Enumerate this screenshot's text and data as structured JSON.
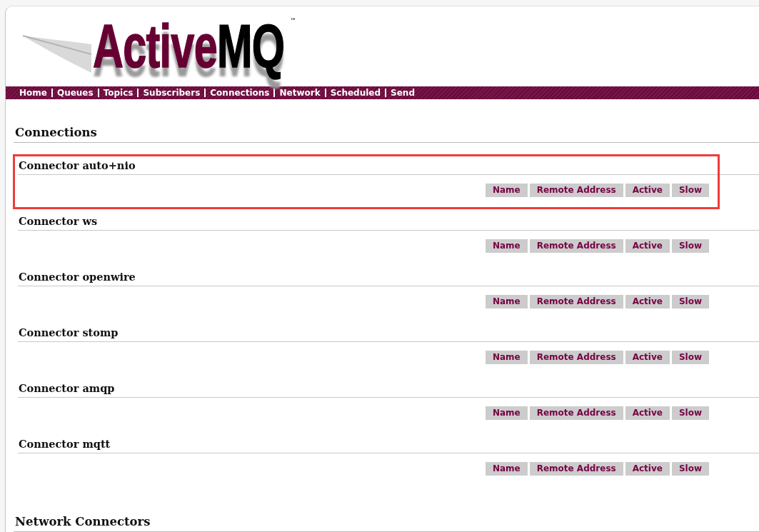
{
  "logo": {
    "name": "Active",
    "suffix": "MQ",
    "trademark": "™"
  },
  "nav": [
    {
      "label": "Home"
    },
    {
      "label": "Queues"
    },
    {
      "label": "Topics"
    },
    {
      "label": "Subscribers"
    },
    {
      "label": "Connections"
    },
    {
      "label": "Network"
    },
    {
      "label": "Scheduled"
    },
    {
      "label": "Send"
    }
  ],
  "sections": [
    {
      "title": "Connections",
      "connectors": [
        {
          "title": "Connector auto+nio",
          "highlighted": true,
          "columns": [
            "Name",
            "Remote Address",
            "Active",
            "Slow"
          ]
        },
        {
          "title": "Connector ws",
          "highlighted": false,
          "columns": [
            "Name",
            "Remote Address",
            "Active",
            "Slow"
          ]
        },
        {
          "title": "Connector openwire",
          "highlighted": false,
          "columns": [
            "Name",
            "Remote Address",
            "Active",
            "Slow"
          ]
        },
        {
          "title": "Connector stomp",
          "highlighted": false,
          "columns": [
            "Name",
            "Remote Address",
            "Active",
            "Slow"
          ]
        },
        {
          "title": "Connector amqp",
          "highlighted": false,
          "columns": [
            "Name",
            "Remote Address",
            "Active",
            "Slow"
          ]
        },
        {
          "title": "Connector mqtt",
          "highlighted": false,
          "columns": [
            "Name",
            "Remote Address",
            "Active",
            "Slow"
          ]
        }
      ]
    },
    {
      "title": "Network Connectors"
    }
  ]
}
